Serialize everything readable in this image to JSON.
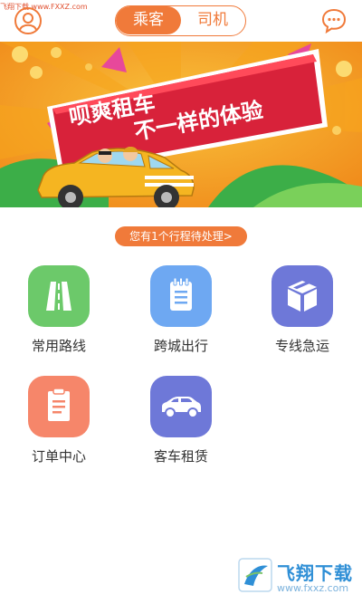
{
  "watermark_top": "飞翔下载 www.FXXZ.com",
  "header": {
    "tabs": [
      {
        "label": "乘客",
        "active": true
      },
      {
        "label": "司机",
        "active": false
      }
    ],
    "avatar_icon": "user-avatar-icon",
    "message_icon": "chat-bubble-icon"
  },
  "banner": {
    "line1": "呗爽租车",
    "line2": "不一样的体验"
  },
  "pending_notice": "您有1个行程待处理>",
  "services": [
    {
      "label": "常用路线",
      "icon": "road-icon",
      "color": "#6cc96a"
    },
    {
      "label": "跨城出行",
      "icon": "notepad-icon",
      "color": "#6ea8f2"
    },
    {
      "label": "专线急运",
      "icon": "box-icon",
      "color": "#6e78d8"
    },
    {
      "label": "订单中心",
      "icon": "clipboard-icon",
      "color": "#f6866a"
    },
    {
      "label": "客车租赁",
      "icon": "car-icon",
      "color": "#6e78d8"
    }
  ],
  "watermark_bottom": {
    "title": "飞翔下载",
    "url": "www.fxxz.com"
  },
  "colors": {
    "accent": "#f07a3a",
    "banner_red": "#d8223a",
    "banner_yellow": "#f7b21a"
  }
}
